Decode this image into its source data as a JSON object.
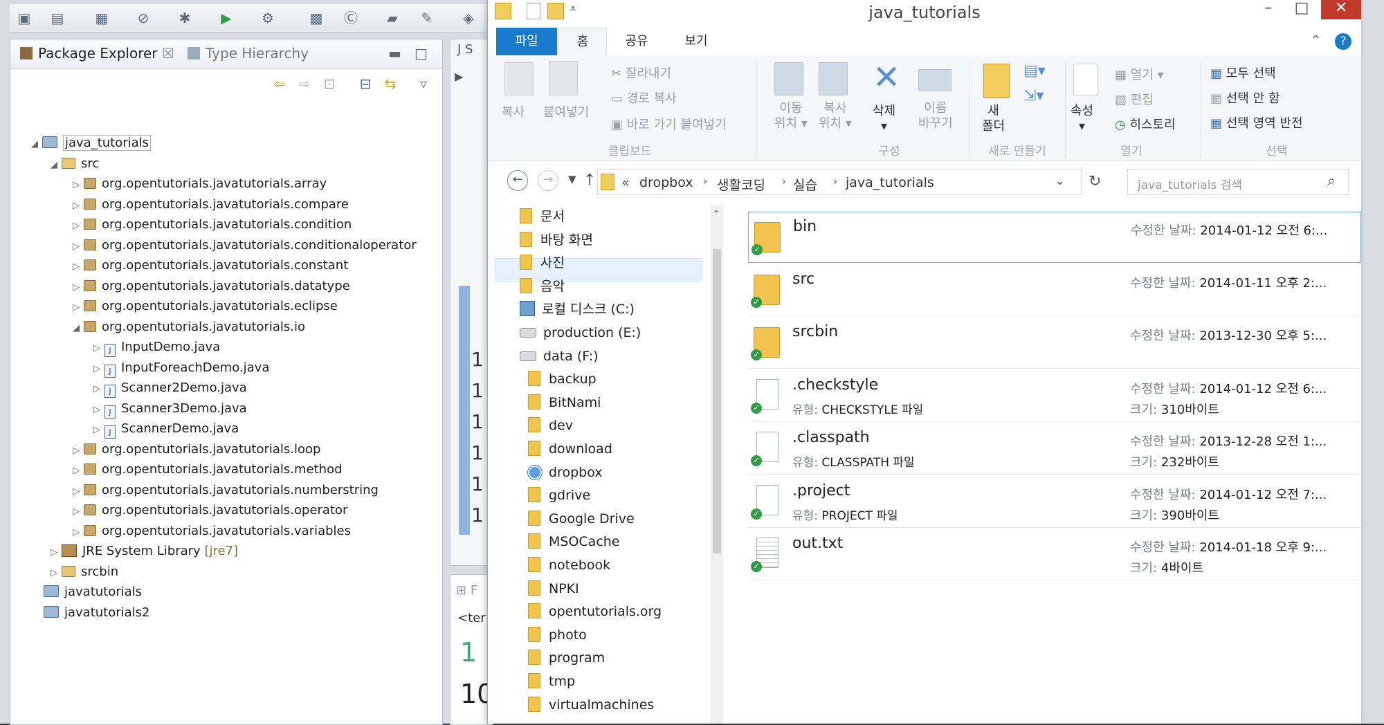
{
  "eclipse": {
    "panel_tabs": [
      "Package Explorer",
      "Type Hierarchy"
    ],
    "project": "java_tutorials",
    "src_folder": "src",
    "packages": [
      "org.opentutorials.javatutorials.array",
      "org.opentutorials.javatutorials.compare",
      "org.opentutorials.javatutorials.condition",
      "org.opentutorials.javatutorials.conditionaloperator",
      "org.opentutorials.javatutorials.constant",
      "org.opentutorials.javatutorials.datatype",
      "org.opentutorials.javatutorials.eclipse",
      "org.opentutorials.javatutorials.io",
      "org.opentutorials.javatutorials.loop",
      "org.opentutorials.javatutorials.method",
      "org.opentutorials.javatutorials.numberstring",
      "org.opentutorials.javatutorials.operator",
      "org.opentutorials.javatutorials.variables"
    ],
    "io_files": [
      "InputDemo.java",
      "InputForeachDemo.java",
      "Scanner2Demo.java",
      "Scanner3Demo.java",
      "ScannerDemo.java"
    ],
    "jre_library": "JRE System Library",
    "jre_version": "[jre7]",
    "srcbin": "srcbin",
    "other_projects": [
      "javatutorials",
      "javatutorials2"
    ],
    "editor_line_nums": [
      "1",
      "1",
      "1",
      "1",
      "1",
      "1"
    ],
    "console_tab": "<ter",
    "console_nums": [
      "1",
      "10"
    ]
  },
  "explorer": {
    "title": "java_tutorials",
    "ribbon_tabs": [
      "파일",
      "홈",
      "공유",
      "보기"
    ],
    "ribbon": {
      "copy": "복사",
      "paste": "붙여넣기",
      "cut": "잘라내기",
      "copy_path": "경로 복사",
      "paste_shortcut": "바로 가기 붙여넣기",
      "group_clipboard": "클립보드",
      "move_to_1": "이동",
      "move_to_2": "위치",
      "copy_to_1": "복사",
      "copy_to_2": "위치",
      "delete": "삭제",
      "rename_1": "이름",
      "rename_2": "바꾸기",
      "group_organize": "구성",
      "new_folder_1": "새",
      "new_folder_2": "폴더",
      "group_new": "새로 만들기",
      "properties": "속성",
      "open": "열기",
      "edit": "편집",
      "history": "히스토리",
      "group_open": "열기",
      "select_all": "모두 선택",
      "select_none": "선택 안 함",
      "invert_selection": "선택 영역 반전",
      "group_select": "선택"
    },
    "address": {
      "prefix": "«",
      "crumbs": [
        "dropbox",
        "생활코딩",
        "실습",
        "java_tutorials"
      ]
    },
    "search_placeholder": "java_tutorials 검색",
    "nav_items": [
      {
        "label": "문서",
        "icon": "folder-icon",
        "indent": 0
      },
      {
        "label": "바탕 화면",
        "icon": "folder-icon",
        "indent": 0
      },
      {
        "label": "사진",
        "icon": "folder-icon",
        "indent": 0
      },
      {
        "label": "음악",
        "icon": "folder-icon",
        "indent": 0
      },
      {
        "label": "로컬 디스크 (C:)",
        "icon": "drive-c-icon",
        "indent": 0
      },
      {
        "label": "production (E:)",
        "icon": "drive-icon",
        "indent": 0
      },
      {
        "label": "data (F:)",
        "icon": "drive-icon",
        "indent": 0
      },
      {
        "label": "backup",
        "icon": "folder-icon",
        "indent": 1
      },
      {
        "label": "BitNami",
        "icon": "folder-icon",
        "indent": 1
      },
      {
        "label": "dev",
        "icon": "folder-icon",
        "indent": 1
      },
      {
        "label": "download",
        "icon": "folder-icon",
        "indent": 1
      },
      {
        "label": "dropbox",
        "icon": "dropbox-icon",
        "indent": 1
      },
      {
        "label": "gdrive",
        "icon": "folder-icon",
        "indent": 1
      },
      {
        "label": "Google Drive",
        "icon": "folder-icon",
        "indent": 1
      },
      {
        "label": "MSOCache",
        "icon": "folder-icon",
        "indent": 1
      },
      {
        "label": "notebook",
        "icon": "folder-icon",
        "indent": 1
      },
      {
        "label": "NPKI",
        "icon": "folder-icon",
        "indent": 1
      },
      {
        "label": "opentutorials.org",
        "icon": "folder-icon",
        "indent": 1
      },
      {
        "label": "photo",
        "icon": "folder-icon",
        "indent": 1
      },
      {
        "label": "program",
        "icon": "folder-icon",
        "indent": 1
      },
      {
        "label": "tmp",
        "icon": "folder-icon",
        "indent": 1
      },
      {
        "label": "virtualmachines",
        "icon": "folder-icon",
        "indent": 1
      }
    ],
    "selected_nav": "dropbox",
    "files": [
      {
        "name": "bin",
        "kind": "folder",
        "modified_label": "수정한 날짜:",
        "modified": "2014-01-12 오전 6:...",
        "type_label": "",
        "type": "",
        "size_label": "",
        "size": ""
      },
      {
        "name": "src",
        "kind": "folder",
        "modified_label": "수정한 날짜:",
        "modified": "2014-01-11 오후 2:...",
        "type_label": "",
        "type": "",
        "size_label": "",
        "size": ""
      },
      {
        "name": "srcbin",
        "kind": "folder",
        "modified_label": "수정한 날짜:",
        "modified": "2013-12-30 오후 5:...",
        "type_label": "",
        "type": "",
        "size_label": "",
        "size": ""
      },
      {
        "name": ".checkstyle",
        "kind": "file",
        "modified_label": "수정한 날짜:",
        "modified": "2014-01-12 오전 6:...",
        "type_label": "유형:",
        "type": "CHECKSTYLE 파일",
        "size_label": "크기:",
        "size": "310바이트"
      },
      {
        "name": ".classpath",
        "kind": "file",
        "modified_label": "수정한 날짜:",
        "modified": "2013-12-28 오전 1:...",
        "type_label": "유형:",
        "type": "CLASSPATH 파일",
        "size_label": "크기:",
        "size": "232바이트"
      },
      {
        "name": ".project",
        "kind": "file",
        "modified_label": "수정한 날짜:",
        "modified": "2014-01-12 오전 7:...",
        "type_label": "유형:",
        "type": "PROJECT 파일",
        "size_label": "크기:",
        "size": "390바이트"
      },
      {
        "name": "out.txt",
        "kind": "text",
        "modified_label": "수정한 날짜:",
        "modified": "2014-01-18 오후 9:...",
        "type_label": "",
        "type": "",
        "size_label": "크기:",
        "size": "4바이트"
      }
    ],
    "colors": {
      "accent": "#1979ca",
      "sync_ok": "#2f9e44",
      "selection": "#e5f1fb"
    }
  }
}
